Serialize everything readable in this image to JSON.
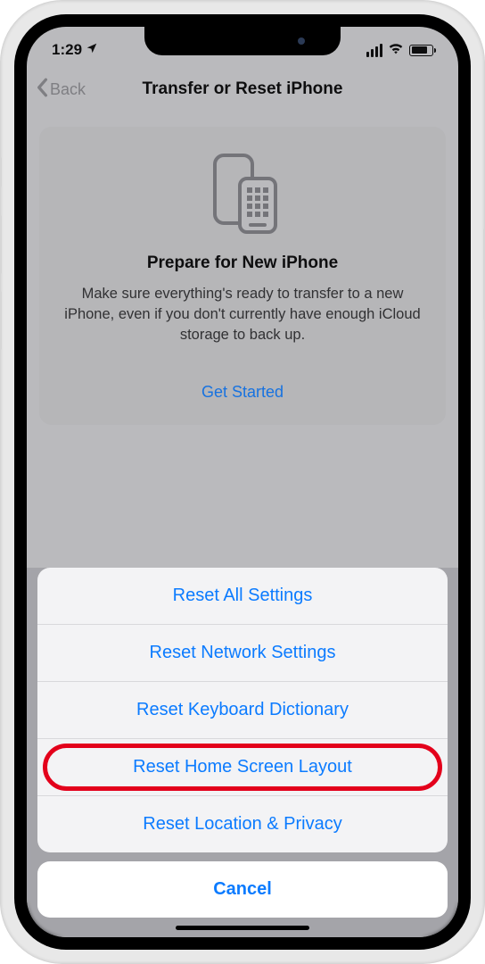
{
  "status": {
    "time": "1:29"
  },
  "nav": {
    "back": "Back",
    "title": "Transfer or Reset iPhone"
  },
  "card": {
    "title": "Prepare for New iPhone",
    "description": "Make sure everything's ready to transfer to a new iPhone, even if you don't currently have enough iCloud storage to back up.",
    "action": "Get Started"
  },
  "sheet": {
    "options": [
      "Reset All Settings",
      "Reset Network Settings",
      "Reset Keyboard Dictionary",
      "Reset Home Screen Layout",
      "Reset Location & Privacy"
    ],
    "highlighted_index": 3,
    "cancel": "Cancel"
  }
}
